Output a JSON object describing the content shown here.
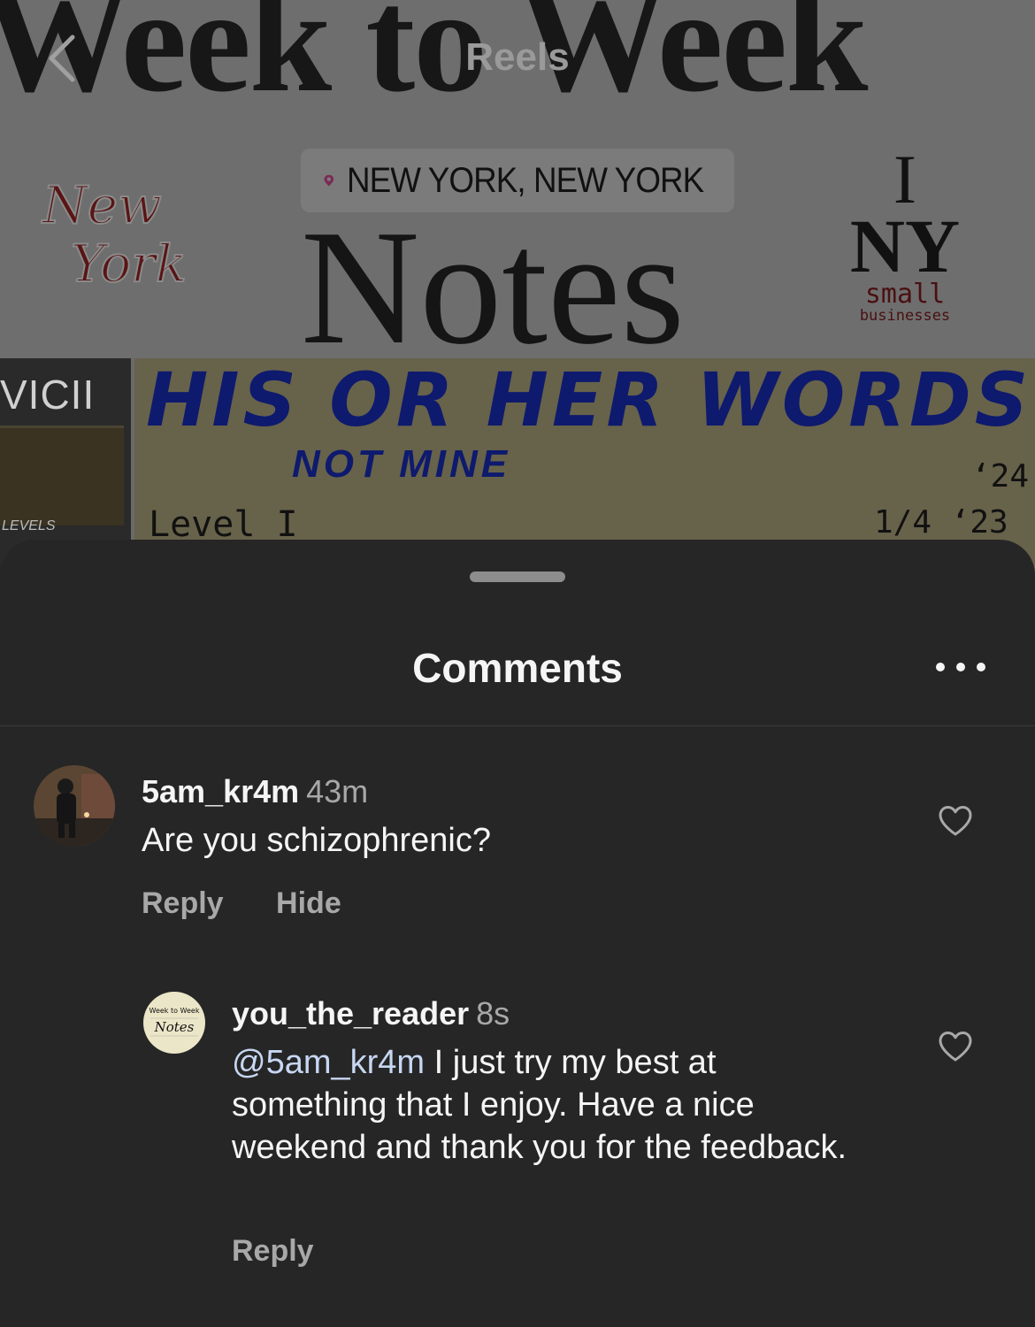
{
  "reel": {
    "nav_title": "Reels",
    "location": "NEW YORK, NEW YORK",
    "masthead": "Week to Week",
    "notes_word": "Notes",
    "script_logo": "New York",
    "iny_line1": "I",
    "iny_line2": "NY",
    "iny_line3": "small",
    "iny_line4": "businesses",
    "side_label": "VICII",
    "side_label2": "LEVELS",
    "words_title": "HIS OR HER WORDS",
    "words_subtitle": "NOT MINE",
    "year": "‘24",
    "level": "Level I",
    "date": "1/4 ‘23"
  },
  "sheet": {
    "title": "Comments"
  },
  "comments": [
    {
      "username": "5am_kr4m",
      "time": "43m",
      "text": "Are you schizophrenic?",
      "reply_label": "Reply",
      "hide_label": "Hide"
    },
    {
      "username": "you_the_reader",
      "time": "8s",
      "mention": "@5am_kr4m",
      "text": " I just try my best at something that I enjoy. Have a nice weekend and thank you for the feedback.",
      "reply_label": "Reply",
      "avatar_line1": "Week to Week",
      "avatar_line2": "Notes"
    }
  ],
  "colors": {
    "sheet_bg": "#262626",
    "text_primary": "#f5f5f5",
    "text_secondary": "#a8a8a8",
    "mention": "#c7d7f2"
  }
}
